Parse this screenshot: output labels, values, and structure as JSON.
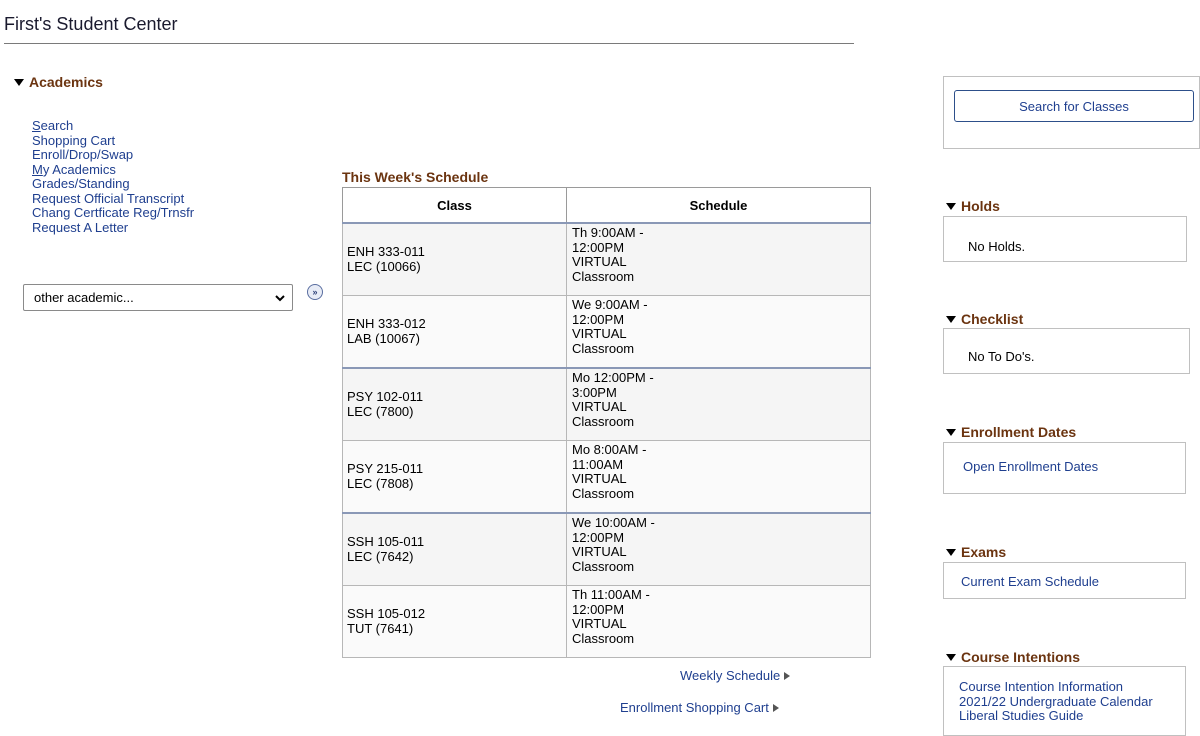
{
  "page": {
    "title": "First's Student Center"
  },
  "academics": {
    "header": "Academics",
    "links": [
      {
        "label": "Search",
        "underline": "S"
      },
      {
        "label": "Shopping Cart"
      },
      {
        "label": "Enroll/Drop/Swap"
      },
      {
        "label": "My Academics",
        "underline": "M"
      },
      {
        "label": "Grades/Standing"
      },
      {
        "label": "Request Official Transcript"
      },
      {
        "label": "Chang Certficate Reg/Trnsfr"
      },
      {
        "label": "Request A Letter"
      }
    ],
    "select_value": "other academic...",
    "go_icon": "double-chevron-right-icon"
  },
  "schedule": {
    "title": "This Week's Schedule",
    "columns": [
      "Class",
      "Schedule"
    ],
    "rows": [
      {
        "class_lines": [
          "ENH 333-011",
          "LEC (10066)"
        ],
        "schedule_lines": [
          "Th 9:00AM -",
          "12:00PM",
          "VIRTUAL",
          "Classroom"
        ]
      },
      {
        "class_lines": [
          "ENH 333-012",
          "LAB (10067)"
        ],
        "schedule_lines": [
          "We 9:00AM -",
          "12:00PM",
          "VIRTUAL",
          "Classroom"
        ]
      },
      {
        "class_lines": [
          "PSY 102-011",
          "LEC (7800)"
        ],
        "schedule_lines": [
          "Mo 12:00PM -",
          "3:00PM",
          "VIRTUAL",
          "Classroom"
        ]
      },
      {
        "class_lines": [
          "PSY 215-011",
          "LEC (7808)"
        ],
        "schedule_lines": [
          "Mo 8:00AM -",
          "11:00AM",
          "VIRTUAL",
          "Classroom"
        ]
      },
      {
        "class_lines": [
          "SSH 105-011",
          "LEC (7642)"
        ],
        "schedule_lines": [
          "We 10:00AM -",
          "12:00PM",
          "VIRTUAL",
          "Classroom"
        ]
      },
      {
        "class_lines": [
          "SSH 105-012",
          "TUT (7641)"
        ],
        "schedule_lines": [
          "Th 11:00AM -",
          "12:00PM",
          "VIRTUAL",
          "Classroom"
        ]
      }
    ],
    "weekly_link": "Weekly Schedule",
    "cart_link": "Enrollment Shopping Cart"
  },
  "right": {
    "search_button": "Search for Classes",
    "holds": {
      "header": "Holds",
      "text": "No Holds."
    },
    "checklist": {
      "header": "Checklist",
      "text": "No To Do's."
    },
    "enrollment_dates": {
      "header": "Enrollment Dates",
      "link": "Open Enrollment Dates"
    },
    "exams": {
      "header": "Exams",
      "link": "Current Exam Schedule"
    },
    "course_intentions": {
      "header": "Course Intentions",
      "links": [
        "Course Intention Information",
        "2021/22 Undergraduate Calendar",
        "Liberal Studies Guide"
      ]
    }
  },
  "colors": {
    "link": "#1f3f8f",
    "section_header": "#6b3410"
  }
}
